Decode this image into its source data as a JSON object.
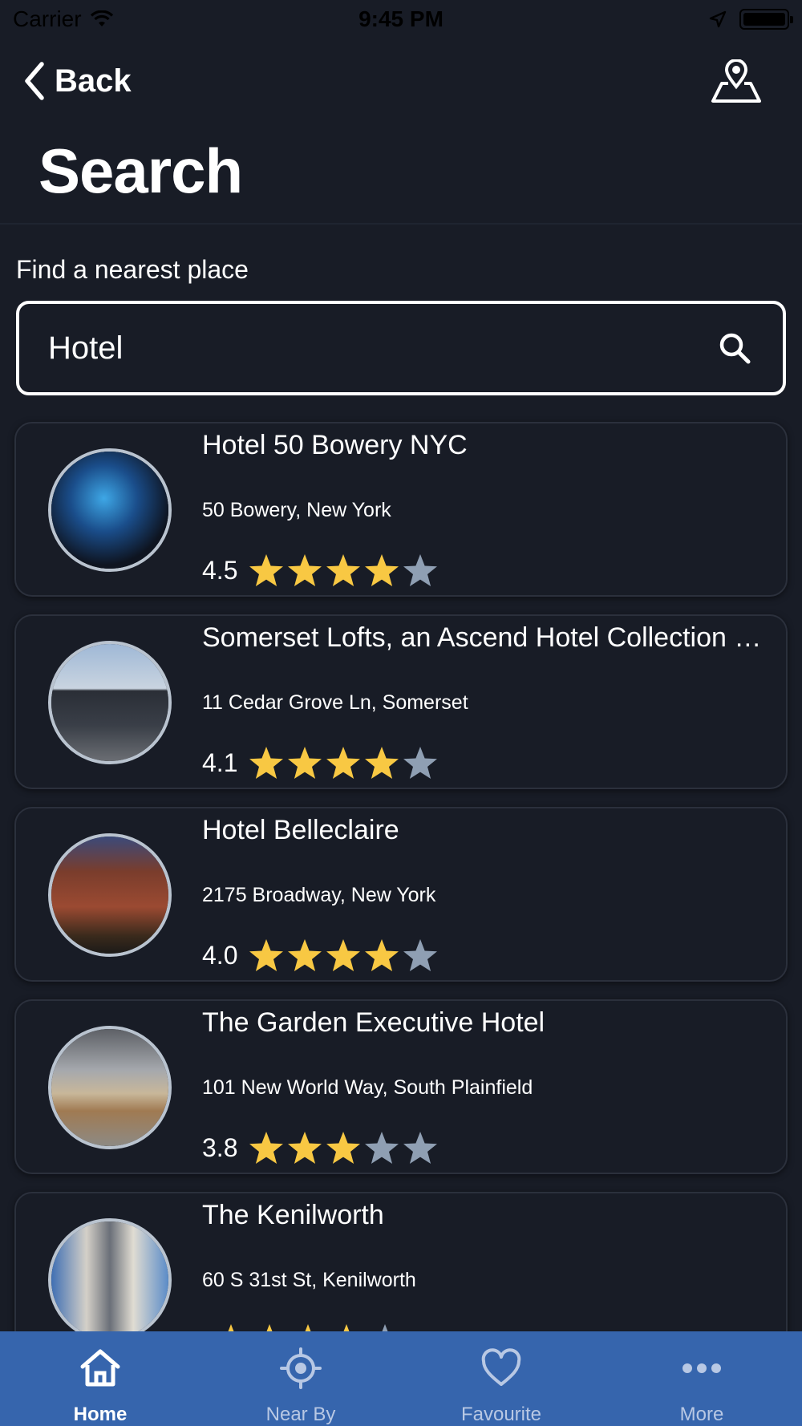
{
  "status_bar": {
    "carrier": "Carrier",
    "time": "9:45 PM"
  },
  "nav": {
    "back_label": "Back",
    "map_icon": "map-pin-icon"
  },
  "page": {
    "title": "Search"
  },
  "search": {
    "label": "Find a nearest place",
    "value": "Hotel",
    "icon": "search-icon"
  },
  "colors": {
    "background": "#181c26",
    "star_filled": "#f8c843",
    "star_empty": "#8f9fb3",
    "tab_bar": "#3665ad"
  },
  "results": [
    {
      "name": "Hotel 50 Bowery NYC",
      "address": "50 Bowery, New York",
      "rating": "4.5",
      "stars_filled": 4
    },
    {
      "name": "Somerset Lofts, an Ascend Hotel Collection Member",
      "address": "11 Cedar Grove Ln, Somerset",
      "rating": "4.1",
      "stars_filled": 4
    },
    {
      "name": "Hotel Belleclaire",
      "address": "2175 Broadway, New York",
      "rating": "4.0",
      "stars_filled": 4
    },
    {
      "name": "The Garden Executive Hotel",
      "address": "101 New World Way, South Plainfield",
      "rating": "3.8",
      "stars_filled": 3
    },
    {
      "name": "The Kenilworth",
      "address": "60 S 31st St, Kenilworth",
      "rating": "",
      "stars_filled": 4
    }
  ],
  "tabs": [
    {
      "label": "Home",
      "icon": "home-icon",
      "active": true
    },
    {
      "label": "Near By",
      "icon": "location-target-icon",
      "active": false
    },
    {
      "label": "Favourite",
      "icon": "heart-icon",
      "active": false
    },
    {
      "label": "More",
      "icon": "more-dots-icon",
      "active": false
    }
  ]
}
